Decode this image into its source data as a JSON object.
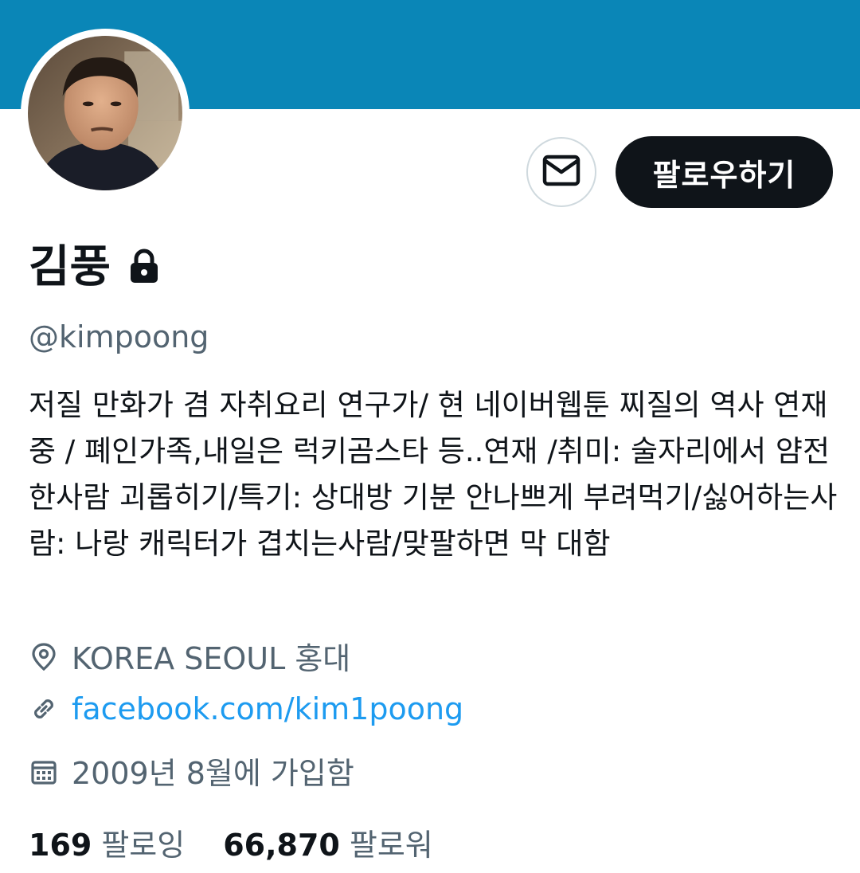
{
  "profile": {
    "display_name": "김풍",
    "handle": "@kimpoong",
    "bio": "저질 만화가 겸 자취요리 연구가/ 현 네이버웹툰 찌질의 역사 연재중 / 폐인가족,내일은 럭키곰스타 등..연재 /취미: 술자리에서 얌전한사람 괴롭히기/특기: 상대방 기분 안나쁘게 부려먹기/싫어하는사람: 나랑 캐릭터가 겹치는사람/맞팔하면 막 대함",
    "location": "KOREA SEOUL 홍대",
    "website": "facebook.com/kim1poong",
    "joined": "2009년 8월에 가입함"
  },
  "actions": {
    "follow_label": "팔로우하기",
    "message_icon": "envelope-icon"
  },
  "stats": {
    "following_count": "169",
    "following_label": "팔로잉",
    "followers_count": "66,870",
    "followers_label": "팔로워"
  },
  "icons": {
    "lock": "lock-icon",
    "location": "location-pin-icon",
    "link": "link-icon",
    "calendar": "calendar-icon"
  },
  "colors": {
    "banner": "#0a86b7",
    "primary_text": "#0f1419",
    "secondary_text": "#536471",
    "link": "#1d9bf0",
    "follow_button_bg": "#0f1419"
  }
}
